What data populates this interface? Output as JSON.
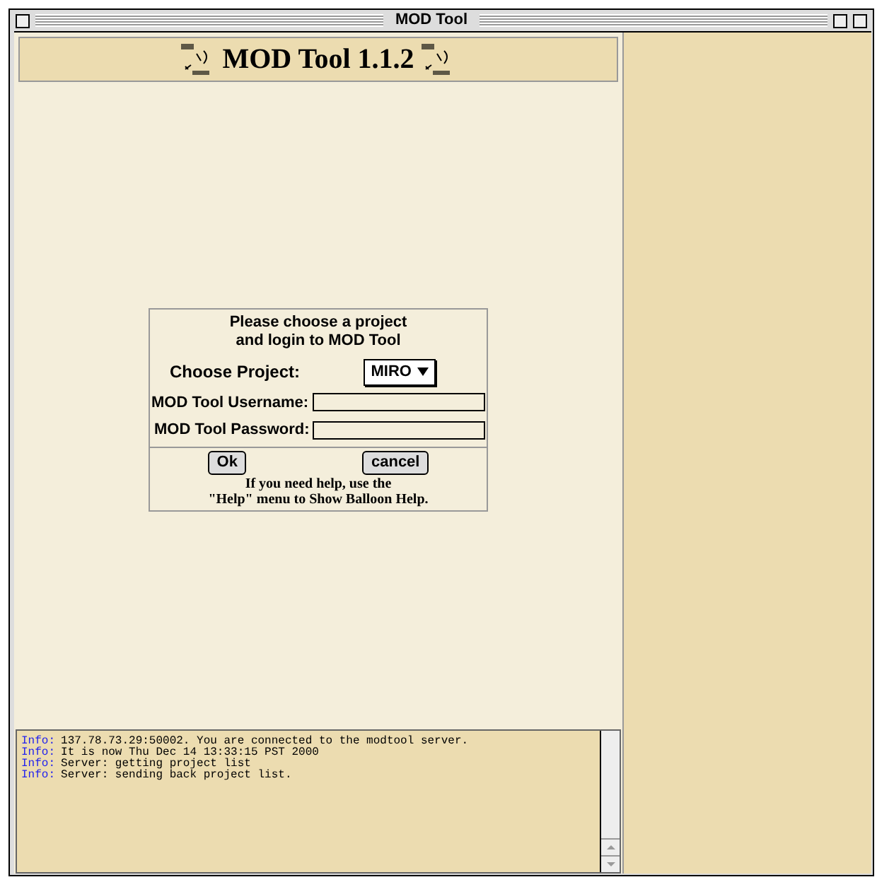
{
  "window": {
    "title": "MOD Tool"
  },
  "header": {
    "title": "MOD Tool 1.1.2"
  },
  "login": {
    "heading_line_1": "Please choose a project",
    "heading_line_2": "and login to MOD Tool",
    "project_label": "Choose Project:",
    "project_value": "MIRO",
    "username_label": "MOD Tool Username:",
    "password_label": "MOD Tool Password:",
    "ok": "Ok",
    "cancel": "cancel",
    "help_line_1": "If you need help, use the",
    "help_line_2": "\"Help\" menu to Show Balloon Help."
  },
  "log": [
    {
      "tag": "Info:",
      "message": "137.78.73.29:50002. You are connected to the modtool server."
    },
    {
      "tag": "Info:",
      "message": "It is now Thu Dec 14 13:33:15 PST 2000"
    },
    {
      "tag": "Info:",
      "message": "Server: getting project list"
    },
    {
      "tag": "Info:",
      "message": "Server: sending back project list."
    }
  ]
}
